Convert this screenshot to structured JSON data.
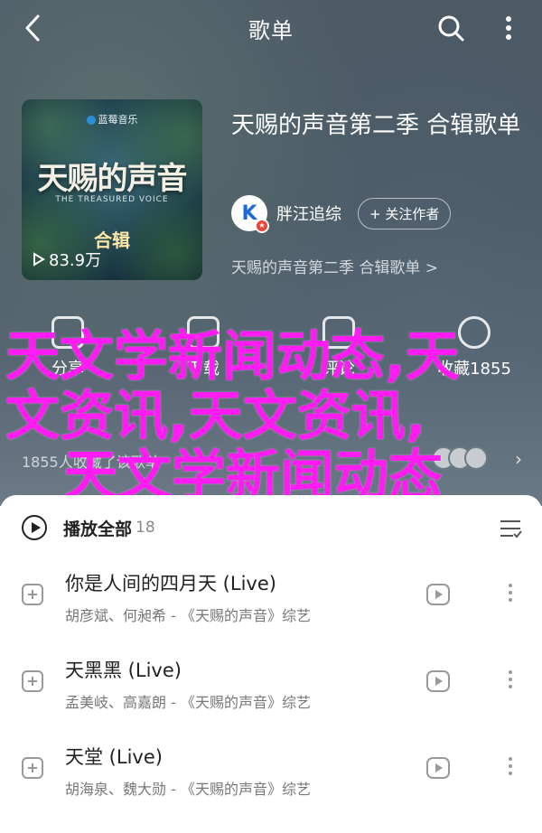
{
  "navbar": {
    "title": "歌单"
  },
  "album": {
    "cover_brand": "蓝莓音乐",
    "cover_title": "天赐的声音",
    "cover_subtitle": "THE TREASURED VOICE",
    "cover_season": "合辑",
    "play_count": "83.9万",
    "title": "天赐的声音第二季 合辑歌单",
    "creator_name": "胖汪追综",
    "follow_label": "+ 关注作者",
    "description": "天赐的声音第二季 合辑歌单 >"
  },
  "actions": [
    {
      "label": "分享",
      "icon": "share-icon"
    },
    {
      "label": "下载",
      "icon": "download-icon"
    },
    {
      "label": "评论",
      "icon": "comment-icon"
    },
    {
      "label": "收藏1855",
      "icon": "favorite-icon"
    }
  ],
  "collected_text": "1855人收藏了该歌单",
  "watermark": {
    "line1": "天文学新闻动态,天",
    "line2": "文资讯,天文资讯,",
    "line3": "天文学新闻动态"
  },
  "playlist": {
    "play_all_label": "播放全部",
    "count": "18",
    "songs": [
      {
        "title": "你是人间的四月天 (Live)",
        "artist": "胡彦斌、何昶希 - 《天赐的声音》综艺"
      },
      {
        "title": "天黑黑 (Live)",
        "artist": "孟美岐、高嘉朗 - 《天赐的声音》综艺"
      },
      {
        "title": "天堂 (Live)",
        "artist": "胡海泉、魏大勋 - 《天赐的声音》综艺"
      }
    ]
  },
  "colors": {
    "header_bg": "#4c5a66",
    "watermark": "#ff1cf2",
    "accent_blue": "#1f6bd6"
  }
}
